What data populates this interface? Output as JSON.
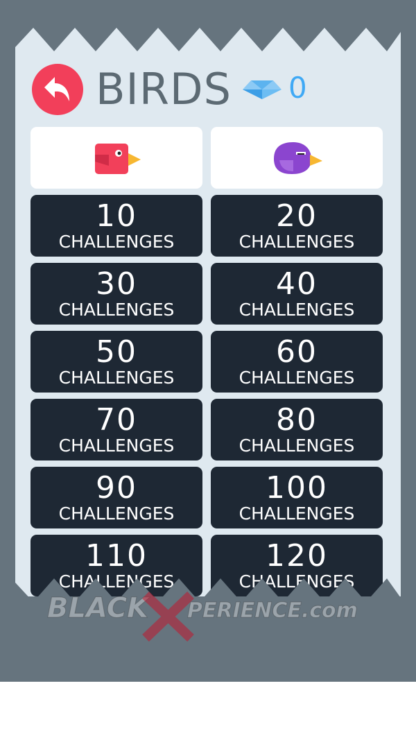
{
  "header": {
    "title": "BIRDS",
    "gem_count": "0",
    "back_icon": "undo-arrow-icon",
    "gem_icon": "diamond-icon"
  },
  "birds": [
    {
      "name": "red-bird",
      "color": "#f2405a",
      "beak": "#f7b731"
    },
    {
      "name": "purple-bird",
      "color": "#8b45cf",
      "beak": "#f7b731"
    }
  ],
  "challenges": [
    {
      "count": "10",
      "label": "CHALLENGES"
    },
    {
      "count": "20",
      "label": "CHALLENGES"
    },
    {
      "count": "30",
      "label": "CHALLENGES"
    },
    {
      "count": "40",
      "label": "CHALLENGES"
    },
    {
      "count": "50",
      "label": "CHALLENGES"
    },
    {
      "count": "60",
      "label": "CHALLENGES"
    },
    {
      "count": "70",
      "label": "CHALLENGES"
    },
    {
      "count": "80",
      "label": "CHALLENGES"
    },
    {
      "count": "90",
      "label": "CHALLENGES"
    },
    {
      "count": "100",
      "label": "CHALLENGES"
    },
    {
      "count": "110",
      "label": "CHALLENGES"
    },
    {
      "count": "120",
      "label": "CHALLENGES"
    }
  ],
  "watermark": {
    "text": "BLACKXPERIENCE.com"
  },
  "colors": {
    "background": "#66747e",
    "paper": "#dfe9f0",
    "tile": "#1e2834",
    "accent_red": "#f23f5a",
    "gem_blue": "#3fa9f5"
  }
}
